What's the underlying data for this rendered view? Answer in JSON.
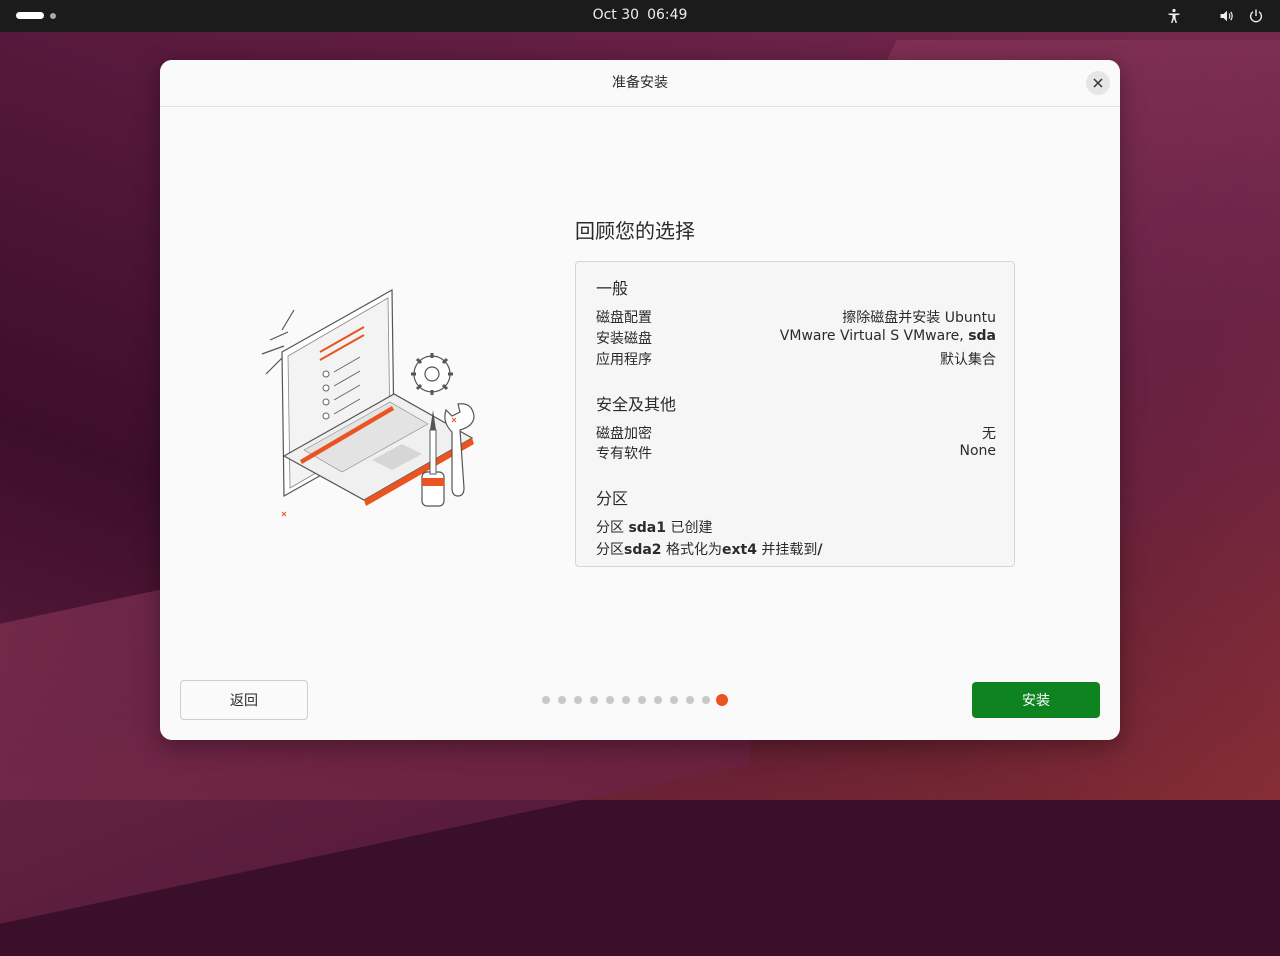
{
  "topbar": {
    "date": "Oct 30",
    "time": "06:49",
    "icons": [
      "accessibility-icon",
      "volume-icon",
      "power-icon"
    ]
  },
  "dialog": {
    "title": "准备安装",
    "review_title": "回顾您的选择",
    "general": {
      "title": "一般",
      "rows": [
        {
          "label": "磁盘配置",
          "value": "擦除磁盘并安装 Ubuntu"
        },
        {
          "label": "安装磁盘",
          "value_prefix": "VMware Virtual S VMware, ",
          "value_bold": "sda"
        },
        {
          "label": "应用程序",
          "value": "默认集合"
        }
      ]
    },
    "security": {
      "title": "安全及其他",
      "rows": [
        {
          "label": "磁盘加密",
          "value": "无"
        },
        {
          "label": "专有软件",
          "value": "None"
        }
      ]
    },
    "partitions": {
      "title": "分区",
      "line1": {
        "prefix": "分区 ",
        "bold": "sda1",
        "suffix": " 已创建"
      },
      "line2": {
        "prefix": "分区",
        "bold1": "sda2",
        "middle": " 格式化为",
        "bold2": "ext4",
        "middle2": " 并挂载到",
        "bold3": "/"
      }
    },
    "back_label": "返回",
    "install_label": "安装",
    "progress": {
      "total": 12,
      "current": 12
    }
  },
  "colors": {
    "accent": "#e95420",
    "install": "#0e8420",
    "topbar": "#1b1b1b"
  }
}
